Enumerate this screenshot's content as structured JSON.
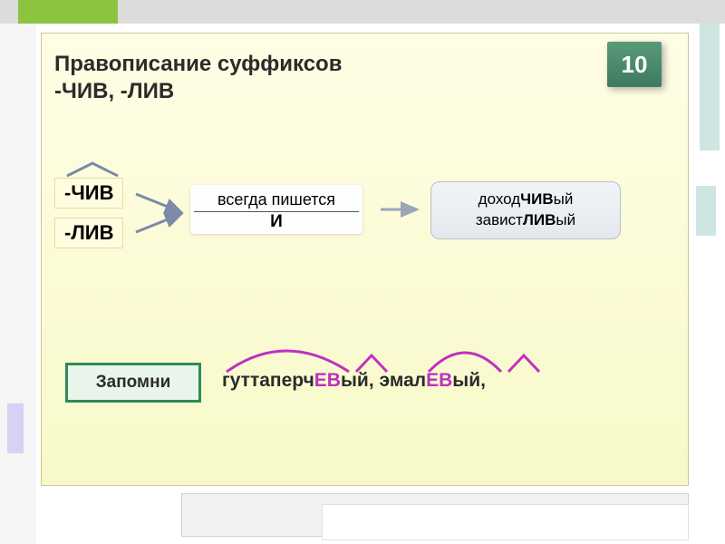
{
  "slide": {
    "number": "10"
  },
  "title": {
    "line1": "Правописание суффиксов",
    "line2": "-ЧИВ, -ЛИВ"
  },
  "suffixes": {
    "chiv": "-ЧИВ",
    "liv": "-ЛИВ"
  },
  "rule": {
    "top": "всегда пишется",
    "emph": "И"
  },
  "examples": {
    "w1_pre": "доход",
    "w1_suf": "ЧИВ",
    "w1_end": "ый",
    "w2_pre": "завист",
    "w2_suf": "ЛИВ",
    "w2_end": "ый"
  },
  "remember": {
    "label": "Запомни"
  },
  "exceptions": {
    "w1_pre": "гуттаперч",
    "w1_ev": "ЕВ",
    "w1_end": "ый",
    "sep": ", ",
    "w2_pre": "эмал",
    "w2_ev": "ЕВ",
    "w2_end": "ый",
    "tail": ","
  }
}
